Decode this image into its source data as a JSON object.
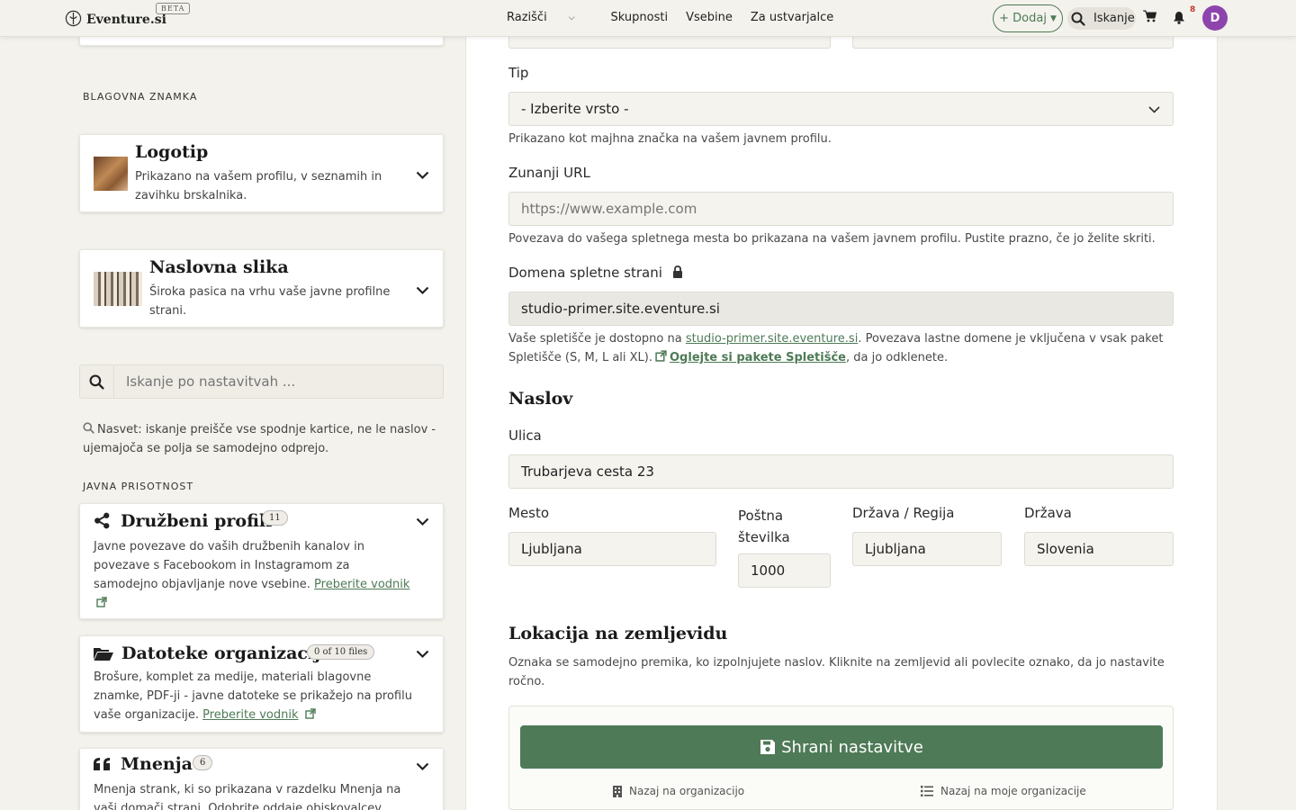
{
  "nav": {
    "brand": "Eventure.si",
    "beta": "BETA",
    "links": [
      "Razišči",
      "Skupnosti",
      "Vsebine",
      "Za ustvarjalce"
    ],
    "add_label": "+ Dodaj",
    "search_label": "Iskanje",
    "notification_count": "8",
    "avatar_letter": "D"
  },
  "sidebar": {
    "brand_section": "BLAGOVNA ZNAMKA",
    "logo_card": {
      "title": "Logotip",
      "desc": "Prikazano na vašem profilu, v seznamih in zavihku brskalnika."
    },
    "cover_card": {
      "title": "Naslovna slika",
      "desc": "Široka pasica na vrhu vaše javne profilne strani."
    },
    "search_placeholder": "Iskanje po nastavitvah ...",
    "tip": "Nasvet: iskanje preišče vse spodnje kartice, ne le naslov - ujemajoča se polja se samodejno odprejo.",
    "presence_section": "JAVNA PRISOTNOST",
    "social_card": {
      "title": "Družbeni profili",
      "badge": "11",
      "desc": "Javne povezave do vaših družbenih kanalov in povezave s Facebookom in Instagramom za samodejno objavljanje nove vsebine.",
      "link": "Preberite vodnik"
    },
    "files_card": {
      "title": "Datoteke organizacije",
      "badge": "0 of 10 files",
      "desc": "Brošure, komplet za medije, materiali blagovne znamke, PDF-ji - javne datoteke se prikažejo na profilu vaše organizacije.",
      "link": "Preberite vodnik"
    },
    "reviews_card": {
      "title": "Mnenja",
      "badge": "6",
      "desc": "Mnenja strank, ki so prikazana v razdelku Mnenja na vaši domači strani. Odobrite oddaje obiskovalcev"
    }
  },
  "form": {
    "type_label": "Tip",
    "type_value": "- Izberite vrsto -",
    "type_hint": "Prikazano kot majhna značka na vašem javnem profilu.",
    "url_label": "Zunanji URL",
    "url_placeholder": "https://www.example.com",
    "url_hint": "Povezava do vašega spletnega mesta bo prikazana na vašem javnem profilu. Pustite prazno, če jo želite skriti.",
    "domain_label": "Domena spletne strani",
    "domain_value": "studio-primer.site.eventure.si",
    "domain_hint_pre": "Vaše spletišče je dostopno na ",
    "domain_hint_link": "studio-primer.site.eventure.si",
    "domain_hint_mid": ". Povezava lastne domene je vključena v vsak paket Spletišče (S, M, L ali XL).",
    "domain_hint_link2": "Oglejte si pakete Spletišče",
    "domain_hint_post": ", da jo odklenete.",
    "address_heading": "Naslov",
    "street_label": "Ulica",
    "street_value": "Trubarjeva cesta 23",
    "city_label": "Mesto",
    "city_value": "Ljubljana",
    "postal_label_1": "Poštna",
    "postal_label_2": "številka",
    "postal_value": "1000",
    "region_label": "Država / Regija",
    "region_value": "Ljubljana",
    "country_label": "Država",
    "country_value": "Slovenia",
    "map_heading": "Lokacija na zemljevidu",
    "map_hint": "Oznaka se samodejno premika, ko izpolnjujete naslov. Kliknite na zemljevid ali povlecite oznako, da jo nastavite ročno.",
    "save_label": "Shrani nastavitve",
    "back_org": "Nazaj na organizacijo",
    "back_my_orgs": "Nazaj na moje organizacije"
  },
  "colors": {
    "accent": "#4e7a57",
    "avatar": "#8e44ad"
  }
}
